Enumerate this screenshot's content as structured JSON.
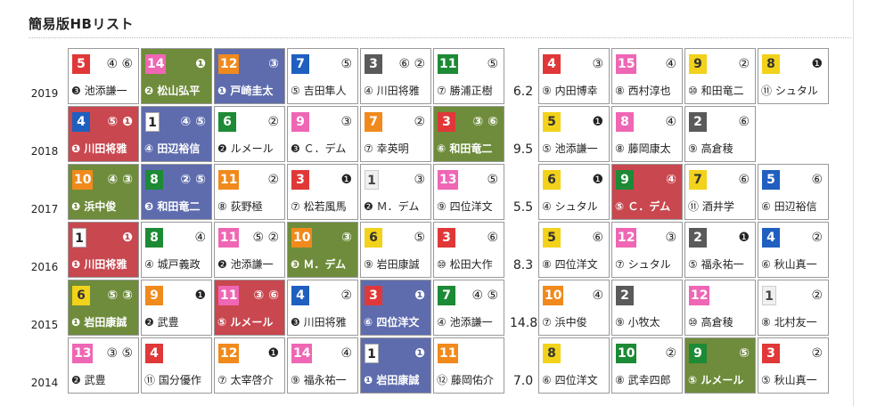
{
  "title": "簡易版HBリスト",
  "rows": [
    {
      "year": "2019",
      "value": "6.2",
      "cells": [
        {
          "gate": "5",
          "gc": "gc3",
          "ranks": "④ ⑥",
          "jockey": "❸ 池添謙一",
          "hl": ""
        },
        {
          "gate": "14",
          "gc": "gc8",
          "ranks": "❶",
          "jockey": "❷ 松山弘平",
          "hl": "green"
        },
        {
          "gate": "12",
          "gc": "gc7",
          "ranks": "③",
          "jockey": "❶ 戸崎圭太",
          "hl": "blue"
        },
        {
          "gate": "7",
          "gc": "gc4",
          "ranks": "⑤",
          "jockey": "⑤ 吉田隼人",
          "hl": ""
        },
        {
          "gate": "3",
          "gc": "gc9",
          "ranks": "⑥ ②",
          "jockey": "④ 川田将雅",
          "hl": ""
        },
        {
          "gate": "11",
          "gc": "gc6",
          "ranks": "⑤",
          "jockey": "⑦ 勝浦正樹",
          "hl": ""
        },
        {
          "gate": "4",
          "gc": "gc3",
          "ranks": "③",
          "jockey": "⑨ 内田博幸",
          "hl": ""
        },
        {
          "gate": "15",
          "gc": "gc8",
          "ranks": "④",
          "jockey": "⑧ 西村淳也",
          "hl": ""
        },
        {
          "gate": "9",
          "gc": "gc5",
          "ranks": "②",
          "jockey": "⑩ 和田竜二",
          "hl": ""
        },
        {
          "gate": "8",
          "gc": "gc5",
          "ranks": "❶",
          "jockey": "⑪ シュタル",
          "hl": ""
        }
      ]
    },
    {
      "year": "2018",
      "value": "9.5",
      "cells": [
        {
          "gate": "4",
          "gc": "gc4",
          "ranks": "⑤ ❶",
          "jockey": "❶ 川田将雅",
          "hl": "red"
        },
        {
          "gate": "1",
          "gc": "gc1",
          "ranks": "④ ⑤",
          "jockey": "④ 田辺裕信",
          "hl": "blue"
        },
        {
          "gate": "6",
          "gc": "gc6",
          "ranks": "②",
          "jockey": "❷ ルメール",
          "hl": ""
        },
        {
          "gate": "9",
          "gc": "gc8",
          "ranks": "③",
          "jockey": "❸ Ｃ．デム",
          "hl": ""
        },
        {
          "gate": "7",
          "gc": "gc7",
          "ranks": "②",
          "jockey": "⑦ 幸英明",
          "hl": ""
        },
        {
          "gate": "3",
          "gc": "gc3",
          "ranks": "③ ⑥",
          "jockey": "⑥ 和田竜二",
          "hl": "green"
        },
        {
          "gate": "5",
          "gc": "gc5",
          "ranks": "❶",
          "jockey": "⑤ 池添謙一",
          "hl": ""
        },
        {
          "gate": "8",
          "gc": "gc8",
          "ranks": "④",
          "jockey": "⑧ 藤岡康太",
          "hl": ""
        },
        {
          "gate": "2",
          "gc": "gc9",
          "ranks": "⑥",
          "jockey": "⑨ 高倉稜",
          "hl": ""
        },
        null
      ]
    },
    {
      "year": "2017",
      "value": "5.5",
      "cells": [
        {
          "gate": "10",
          "gc": "gc7",
          "ranks": "④ ③",
          "jockey": "❶ 浜中俊",
          "hl": "green"
        },
        {
          "gate": "8",
          "gc": "gc6",
          "ranks": "② ⑤",
          "jockey": "❸ 和田竜二",
          "hl": "blue"
        },
        {
          "gate": "11",
          "gc": "gc7",
          "ranks": "②",
          "jockey": "⑧ 荻野極",
          "hl": ""
        },
        {
          "gate": "3",
          "gc": "gc3",
          "ranks": "❶",
          "jockey": "⑦ 松若風馬",
          "hl": ""
        },
        {
          "gate": "1",
          "gc": "gc2",
          "ranks": "③",
          "jockey": "❷ Ｍ．デム",
          "hl": ""
        },
        {
          "gate": "13",
          "gc": "gc8",
          "ranks": "⑤",
          "jockey": "⑨ 四位洋文",
          "hl": ""
        },
        {
          "gate": "6",
          "gc": "gc5",
          "ranks": "❶",
          "jockey": "④ シュタル",
          "hl": ""
        },
        {
          "gate": "9",
          "gc": "gc6",
          "ranks": "④",
          "jockey": "⑤ Ｃ．デム",
          "hl": "red"
        },
        {
          "gate": "7",
          "gc": "gc5",
          "ranks": "⑥",
          "jockey": "⑪ 酒井学",
          "hl": ""
        },
        {
          "gate": "5",
          "gc": "gc4",
          "ranks": "⑥",
          "jockey": "⑥ 田辺裕信",
          "hl": ""
        }
      ]
    },
    {
      "year": "2016",
      "value": "8.3",
      "cells": [
        {
          "gate": "1",
          "gc": "gc1",
          "ranks": "❶",
          "jockey": "❶ 川田将雅",
          "hl": "red"
        },
        {
          "gate": "8",
          "gc": "gc6",
          "ranks": "④",
          "jockey": "④ 城戸義政",
          "hl": ""
        },
        {
          "gate": "11",
          "gc": "gc8",
          "ranks": "⑤ ②",
          "jockey": "❷ 池添謙一",
          "hl": ""
        },
        {
          "gate": "10",
          "gc": "gc7",
          "ranks": "③",
          "jockey": "❸ Ｍ．デム",
          "hl": "green"
        },
        {
          "gate": "6",
          "gc": "gc5",
          "ranks": "⑤",
          "jockey": "⑨ 岩田康誠",
          "hl": ""
        },
        {
          "gate": "3",
          "gc": "gc3",
          "ranks": "⑥",
          "jockey": "⑩ 松田大作",
          "hl": ""
        },
        {
          "gate": "5",
          "gc": "gc5",
          "ranks": "⑥",
          "jockey": "⑧ 四位洋文",
          "hl": ""
        },
        {
          "gate": "12",
          "gc": "gc8",
          "ranks": "③",
          "jockey": "⑦ シュタル",
          "hl": ""
        },
        {
          "gate": "2",
          "gc": "gc9",
          "ranks": "❶",
          "jockey": "⑤ 福永祐一",
          "hl": ""
        },
        {
          "gate": "4",
          "gc": "gc4",
          "ranks": "②",
          "jockey": "⑥ 秋山真一",
          "hl": ""
        }
      ]
    },
    {
      "year": "2015",
      "value": "14.8",
      "cells": [
        {
          "gate": "6",
          "gc": "gc5",
          "ranks": "⑤ ③",
          "jockey": "❶ 岩田康誠",
          "hl": "green"
        },
        {
          "gate": "9",
          "gc": "gc7",
          "ranks": "❶",
          "jockey": "❷ 武豊",
          "hl": ""
        },
        {
          "gate": "11",
          "gc": "gc8",
          "ranks": "③ ⑥",
          "jockey": "⑤ ルメール",
          "hl": "red"
        },
        {
          "gate": "4",
          "gc": "gc4",
          "ranks": "②",
          "jockey": "❸ 川田将雅",
          "hl": ""
        },
        {
          "gate": "3",
          "gc": "gc3",
          "ranks": "❶",
          "jockey": "⑥ 四位洋文",
          "hl": "blue"
        },
        {
          "gate": "7",
          "gc": "gc6",
          "ranks": "④ ⑤",
          "jockey": "④ 池添謙一",
          "hl": ""
        },
        {
          "gate": "10",
          "gc": "gc7",
          "ranks": "④",
          "jockey": "⑦ 浜中俊",
          "hl": ""
        },
        {
          "gate": "2",
          "gc": "gc9",
          "ranks": "",
          "jockey": "⑨ 小牧太",
          "hl": ""
        },
        {
          "gate": "12",
          "gc": "gc8",
          "ranks": "",
          "jockey": "⑩ 高倉稜",
          "hl": ""
        },
        {
          "gate": "1",
          "gc": "gc2",
          "ranks": "②",
          "jockey": "⑧ 北村友一",
          "hl": ""
        }
      ]
    },
    {
      "year": "2014",
      "value": "7.0",
      "cells": [
        {
          "gate": "13",
          "gc": "gc8",
          "ranks": "③ ⑤",
          "jockey": "❷ 武豊",
          "hl": ""
        },
        {
          "gate": "4",
          "gc": "gc3",
          "ranks": "",
          "jockey": "⑪ 国分優作",
          "hl": ""
        },
        {
          "gate": "12",
          "gc": "gc7",
          "ranks": "❶",
          "jockey": "⑦ 太宰啓介",
          "hl": ""
        },
        {
          "gate": "14",
          "gc": "gc8",
          "ranks": "④",
          "jockey": "⑨ 福永祐一",
          "hl": ""
        },
        {
          "gate": "1",
          "gc": "gc1",
          "ranks": "❶",
          "jockey": "❶ 岩田康誠",
          "hl": "blue"
        },
        {
          "gate": "11",
          "gc": "gc7",
          "ranks": "",
          "jockey": "⑫ 藤岡佑介",
          "hl": ""
        },
        {
          "gate": "8",
          "gc": "gc5",
          "ranks": "",
          "jockey": "⑥ 四位洋文",
          "hl": ""
        },
        {
          "gate": "10",
          "gc": "gc6",
          "ranks": "②",
          "jockey": "⑧ 武幸四郎",
          "hl": ""
        },
        {
          "gate": "9",
          "gc": "gc6",
          "ranks": "⑤",
          "jockey": "⑤ ルメール",
          "hl": "green"
        },
        {
          "gate": "3",
          "gc": "gc3",
          "ranks": "②",
          "jockey": "⑤ 秋山真一",
          "hl": ""
        }
      ]
    }
  ]
}
